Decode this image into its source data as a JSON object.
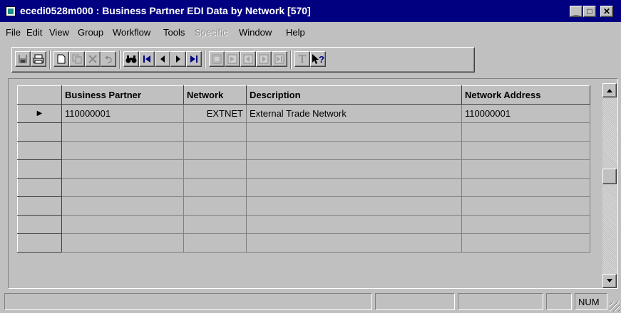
{
  "window": {
    "title": "ecedi0528m000 : Business Partner EDI Data by Network [570]",
    "buttons": {
      "minimize": "_",
      "maximize": "□",
      "close": "✕"
    }
  },
  "menu": [
    "File",
    "Edit",
    "View",
    "Group",
    "Workflow",
    "Tools",
    "Specific",
    "Window",
    "Help"
  ],
  "menu_disabled": [
    "Specific"
  ],
  "toolbar": {
    "icons": [
      "save-icon",
      "print-icon",
      "new-icon",
      "copy-icon",
      "delete-icon",
      "undo-icon",
      "find-icon",
      "first-record-icon",
      "previous-record-icon",
      "next-record-icon",
      "last-record-icon",
      "form-icon-1",
      "form-icon-2",
      "form-icon-3",
      "form-icon-4",
      "form-icon-5",
      "text-icon",
      "help-pointer-icon"
    ],
    "text_icon_label": "T",
    "help_label": "?"
  },
  "grid": {
    "columns": [
      "Business Partner",
      "Network",
      "Description",
      "Network Address"
    ],
    "rows": [
      {
        "business_partner": "110000001",
        "network": "EXTNET",
        "description": "External Trade Network",
        "network_address": "110000001"
      },
      {
        "business_partner": "",
        "network": "",
        "description": "",
        "network_address": ""
      },
      {
        "business_partner": "",
        "network": "",
        "description": "",
        "network_address": ""
      },
      {
        "business_partner": "",
        "network": "",
        "description": "",
        "network_address": ""
      },
      {
        "business_partner": "",
        "network": "",
        "description": "",
        "network_address": ""
      },
      {
        "business_partner": "",
        "network": "",
        "description": "",
        "network_address": ""
      },
      {
        "business_partner": "",
        "network": "",
        "description": "",
        "network_address": ""
      },
      {
        "business_partner": "",
        "network": "",
        "description": "",
        "network_address": ""
      }
    ],
    "current_row_marker": "▶"
  },
  "statusbar": {
    "num": "NUM"
  },
  "colors": {
    "titlebar": "#000080",
    "face": "#c0c0c0"
  }
}
